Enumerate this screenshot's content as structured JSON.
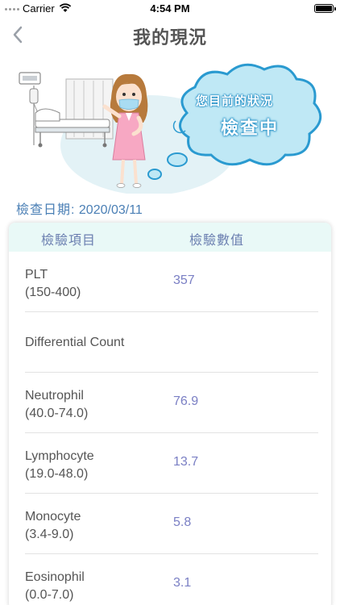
{
  "status_bar": {
    "carrier": "Carrier",
    "time": "4:54 PM"
  },
  "nav": {
    "title": "我的現況"
  },
  "bubble": {
    "line1": "您目前的狀況",
    "line2": "檢查中"
  },
  "check_date": {
    "label": "檢查日期:",
    "value": "2020/03/11"
  },
  "table": {
    "headers": {
      "item": "檢驗項目",
      "value": "檢驗數值"
    },
    "rows": [
      {
        "name": "PLT",
        "range": "(150-400)",
        "value": "357"
      },
      {
        "name": "Differential Count",
        "range": "",
        "value": ""
      },
      {
        "name": "Neutrophil",
        "range": "(40.0-74.0)",
        "value": "76.9"
      },
      {
        "name": "Lymphocyte",
        "range": "(19.0-48.0)",
        "value": "13.7"
      },
      {
        "name": "Monocyte",
        "range": "(3.4-9.0)",
        "value": "5.8"
      },
      {
        "name": "Eosinophil",
        "range": "(0.0-7.0)",
        "value": "3.1"
      }
    ]
  },
  "colors": {
    "accent": "#4a7fb5",
    "value_text": "#7a7fc4",
    "header_bg": "#e9f9f7",
    "bubble_bg": "#bfe8f5"
  },
  "icons": [
    "signal-icon",
    "wifi-icon",
    "battery-icon",
    "back-chevron-icon",
    "nurse-illustration",
    "speech-bubble-icon"
  ]
}
